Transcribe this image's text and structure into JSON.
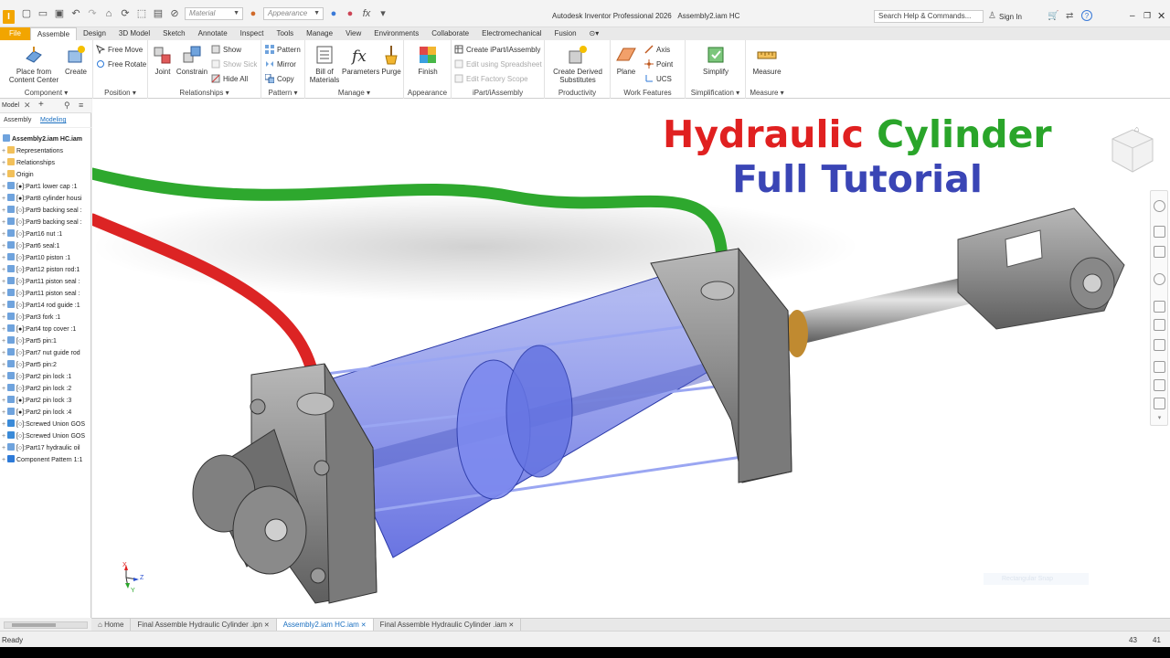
{
  "app": {
    "title": "Autodesk Inventor Professional 2026",
    "document": "Assembly2.iam HC",
    "logo_letter": "I",
    "search_placeholder": "Search Help & Commands...",
    "sign_in": "Sign In",
    "material_placeholder": "Material",
    "appearance_placeholder": "Appearance",
    "fx_label": "fx"
  },
  "menu_tabs": [
    "File",
    "Assemble",
    "Design",
    "3D Model",
    "Sketch",
    "Annotate",
    "Inspect",
    "Tools",
    "Manage",
    "View",
    "Environments",
    "Collaborate",
    "Electromechanical",
    "Fusion"
  ],
  "ribbon": {
    "component": {
      "title": "Component",
      "place": "Place from\nContent Center",
      "create": "Create"
    },
    "position": {
      "title": "Position",
      "free_move": "Free Move",
      "free_rotate": "Free Rotate"
    },
    "relationships": {
      "title": "Relationships",
      "joint": "Joint",
      "constrain": "Constrain",
      "show": "Show",
      "show_sick": "Show Sick",
      "hide_all": "Hide All"
    },
    "pattern": {
      "title": "Pattern",
      "pattern": "Pattern",
      "mirror": "Mirror",
      "copy": "Copy"
    },
    "manage": {
      "title": "Manage",
      "bom": "Bill of\nMaterials",
      "parameters": "Parameters",
      "purge": "Purge"
    },
    "appearance": {
      "title": "Appearance",
      "finish": "Finish"
    },
    "ipart": {
      "title": "iPart/iAssembly",
      "create": "Create iPart/iAssembly",
      "edit_spreadsheet": "Edit using Spreadsheet",
      "edit_scope": "Edit Factory Scope"
    },
    "productivity": {
      "title": "Productivity",
      "derived": "Create Derived\nSubstitutes"
    },
    "work_features": {
      "title": "Work Features",
      "plane": "Plane",
      "axis": "Axis",
      "point": "Point",
      "ucs": "UCS"
    },
    "simplification": {
      "title": "Simplification",
      "simplify": "Simplify"
    },
    "measure": {
      "title": "Measure",
      "measure": "Measure"
    }
  },
  "browser": {
    "header_tab": "Model",
    "sub_tabs": [
      "Assembly",
      "Modeling"
    ],
    "root": "Assembly2.iam HC.iam",
    "items": [
      "Representations",
      "Relationships",
      "Origin",
      "[●]:Part1 lower cap :1",
      "[●]:Part8 cylinder housi",
      "[○]:Part9 backing seal :",
      "[○]:Part9 backing seal :",
      "[○]:Part16 nut :1",
      "[○]:Part6 seal:1",
      "[○]:Part10 piston :1",
      "[○]:Part12 piston rod:1",
      "[○]:Part11 piston seal :",
      "[○]:Part11 piston seal :",
      "[○]:Part14 rod guide :1",
      "[○]:Part3 fork :1",
      "[●]:Part4 top cover :1",
      "[○]:Part5 pin:1",
      "[○]:Part7 nut guide rod",
      "[○]:Part5 pin:2",
      "[○]:Part2 pin lock :1",
      "[○]:Part2 pin lock :2",
      "[●]:Part2 pin lock :3",
      "[●]:Part2 pin lock :4",
      "[○]:Screwed Union GOS",
      "[○]:Screwed Union GOS",
      "[○]:Part17 hydraulic oil",
      "Component Pattern 1:1"
    ]
  },
  "headline": {
    "word1": "Hydraulic",
    "word2": "Cylinder",
    "line2": "Full Tutorial"
  },
  "colors": {
    "red": "#e02020",
    "green": "#2aa52a",
    "blue": "#3a45b5",
    "accent": "#f2a500",
    "link": "#1a6fc0"
  },
  "axis": {
    "x": "X",
    "y": "Y",
    "z": "Z"
  },
  "faded_hint": "Rectangular Snap",
  "doc_tabs": [
    "Home",
    "Final Assemble Hydraulic Cylinder .ipn",
    "Assembly2.iam HC.iam",
    "Final Assemble Hydraulic Cylinder .iam"
  ],
  "status": {
    "text": "Ready",
    "n1": "43",
    "n2": "41"
  }
}
